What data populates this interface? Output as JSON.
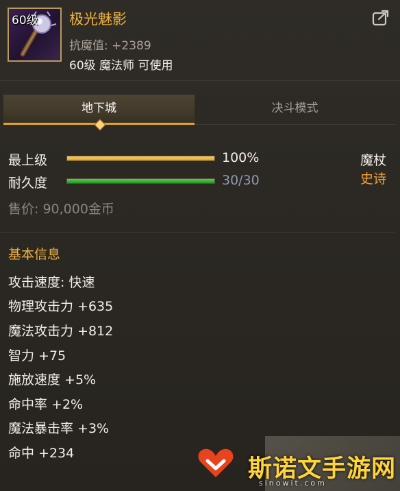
{
  "item": {
    "level_badge": "60级",
    "name": "极光魅影",
    "stat_line": "抗魔值: +2389",
    "requirement": "60级 魔法师 可使用",
    "type": "魔杖",
    "rarity": "史诗",
    "icon": "magic-staff-icon"
  },
  "tabs": [
    {
      "label": "地下城",
      "active": true
    },
    {
      "label": "决斗模式",
      "active": false
    }
  ],
  "bars": {
    "grade": {
      "label": "最上级",
      "value_text": "100%",
      "fill": 1.0
    },
    "durability": {
      "label": "耐久度",
      "value_text": "30/30",
      "fill": 1.0
    }
  },
  "sell_price": "售价: 90,000金币",
  "basic_info": {
    "title": "基本信息",
    "lines": [
      "攻击速度: 快速",
      "物理攻击力 +635",
      "魔法攻击力 +812",
      "智力 +75",
      "施放速度 +5%",
      "命中率 +2%",
      "魔法暴击率 +3%",
      "命中 +234"
    ]
  },
  "watermark": {
    "text": "斯诺文手游网",
    "sub": "sinowit.com"
  },
  "colors": {
    "accent_gold": "#f0b13b",
    "rarity_epic": "#f0a22f",
    "bar_gold": "#e2a226",
    "bar_green": "#219a20",
    "value_blue": "#8f9bb2"
  }
}
